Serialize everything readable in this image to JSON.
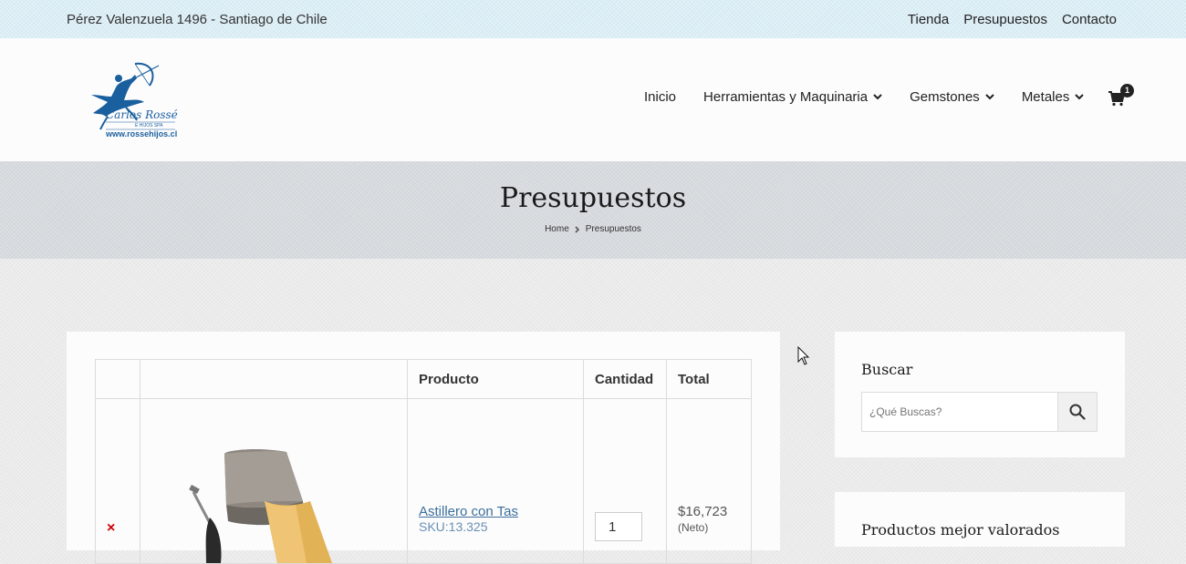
{
  "topbar": {
    "address": "Pérez Valenzuela 1496 - Santiago de Chile",
    "links": [
      "Tienda",
      "Presupuestos",
      "Contacto"
    ]
  },
  "logo": {
    "name": "Carlos Rossé",
    "tagline": "E HIJOS SPA",
    "url": "www.rossehijos.cl",
    "color": "#1a5f9e"
  },
  "nav": {
    "items": [
      {
        "label": "Inicio",
        "has_dropdown": false
      },
      {
        "label": "Herramientas y Maquinaria",
        "has_dropdown": true
      },
      {
        "label": "Gemstones",
        "has_dropdown": true
      },
      {
        "label": "Metales",
        "has_dropdown": true
      }
    ],
    "cart_icon": "cart-icon",
    "cart_count": "1"
  },
  "hero": {
    "title": "Presupuestos",
    "breadcrumb": [
      "Home",
      "Presupuestos"
    ]
  },
  "cart_table": {
    "headers": [
      "",
      "",
      "Producto",
      "Cantidad",
      "Total"
    ],
    "rows": [
      {
        "remove_icon": "×",
        "product_name": " Astillero con Tas",
        "sku": "SKU:13.325",
        "quantity": "1",
        "total": "$16,723",
        "note": "(Neto)"
      }
    ]
  },
  "sidebar": {
    "search": {
      "title": "Buscar",
      "placeholder": "¿Qué Buscas?",
      "button_icon": "search-icon"
    },
    "top_rated": {
      "title": "Productos mejor valorados"
    }
  },
  "colors": {
    "topbar_bg": "#d3e9f2",
    "hero_bg": "#d2d6da",
    "link": "#3b6e9a",
    "remove": "#d00000"
  }
}
